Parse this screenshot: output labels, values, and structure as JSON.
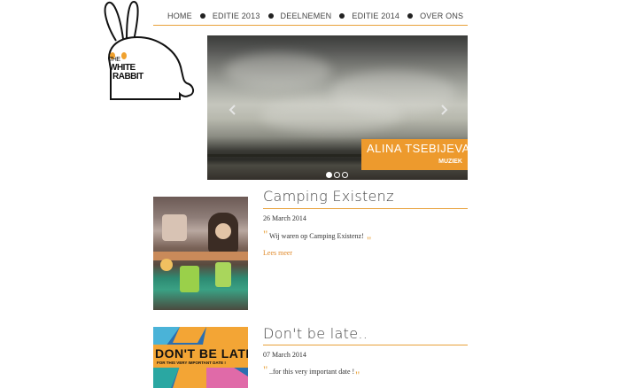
{
  "logo": {
    "line1": "THE",
    "line2": "WHITE",
    "line3": "RABBIT"
  },
  "nav": {
    "items": [
      {
        "label": "HOME"
      },
      {
        "label": "EDITIE 2013"
      },
      {
        "label": "DEELNEMEN"
      },
      {
        "label": "EDITIE 2014"
      },
      {
        "label": "OVER ONS"
      }
    ]
  },
  "slider": {
    "caption_name": "ALINA TSEBIJEVA",
    "caption_category": "MUZIEK",
    "slide_count": 3,
    "active_slide": 1,
    "prev_icon": "chevron-left-icon",
    "next_icon": "chevron-right-icon"
  },
  "posts": [
    {
      "title": "Camping Existenz",
      "date": "26 March 2014",
      "excerpt": "Wij waren op Camping Existenz!",
      "read_more": "Lees meer"
    },
    {
      "title": "Don't be late..",
      "date": "07 March 2014",
      "excerpt": "..for this very important date !",
      "poster_text": "DON'T BE LATE",
      "poster_subtext": "FOR THIS VERY IMPORTANT DATE !"
    }
  ],
  "colors": {
    "accent": "#ed9a2d",
    "rule": "#e8a13a"
  }
}
